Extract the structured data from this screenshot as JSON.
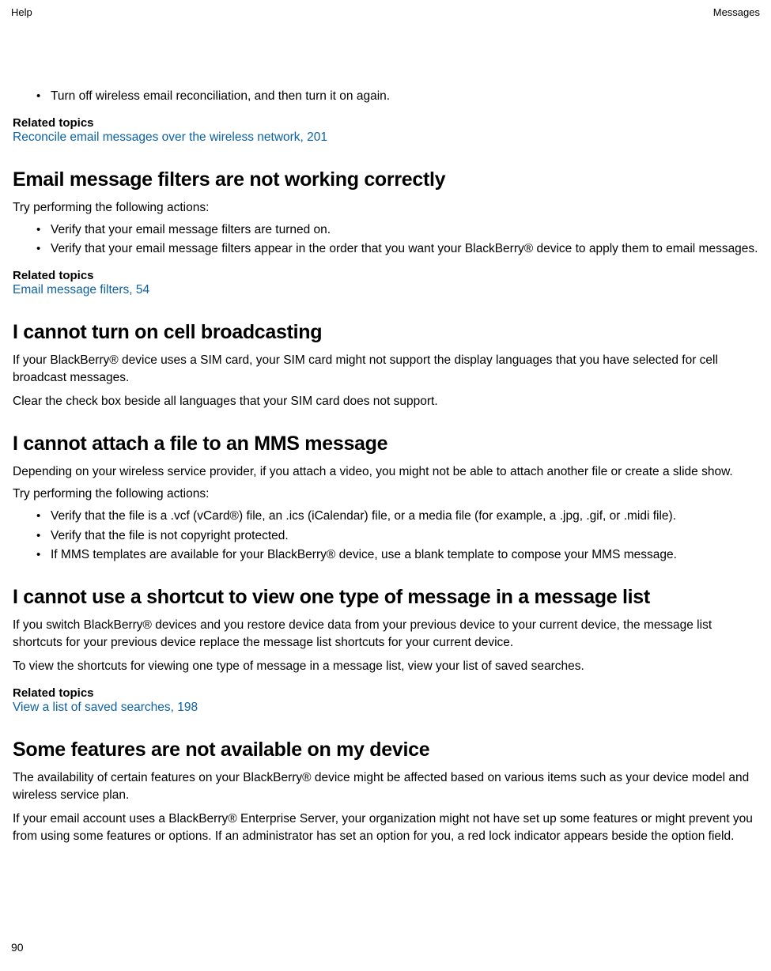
{
  "header": {
    "left": "Help",
    "right": "Messages"
  },
  "intro": {
    "bullet": "Turn off wireless email reconciliation, and then turn it on again."
  },
  "rt1": {
    "label": "Related topics",
    "link": "Reconcile email messages over the wireless network, 201"
  },
  "sec_filters": {
    "heading": "Email message filters are not working correctly",
    "intro": "Try performing the following actions:",
    "b1": "Verify that your email message filters are turned on.",
    "b2": "Verify that your email message filters appear in the order that you want your BlackBerry® device to apply them to email messages."
  },
  "rt2": {
    "label": "Related topics",
    "link": "Email message filters, 54"
  },
  "sec_cell": {
    "heading": "I cannot turn on cell broadcasting",
    "p1": "If your BlackBerry® device uses a SIM card, your SIM card might not support the display languages that you have selected for cell broadcast messages.",
    "p2": "Clear the check box beside all languages that your SIM card does not support."
  },
  "sec_mms": {
    "heading": "I cannot attach a file to an MMS message",
    "p1": "Depending on your wireless service provider, if you attach a video, you might not be able to attach another file or create a slide show.",
    "p2": "Try performing the following actions:",
    "b1": "Verify that the file is a .vcf (vCard®) file, an .ics (iCalendar) file, or a media file (for example, a .jpg, .gif, or .midi file).",
    "b2": "Verify that the file is not copyright protected.",
    "b3": "If MMS templates are available for your BlackBerry® device, use a blank template to compose your MMS message."
  },
  "sec_shortcut": {
    "heading": "I cannot use a shortcut to view one type of message in a message list",
    "p1": "If you switch BlackBerry® devices and you restore device data from your previous device to your current device, the message list shortcuts for your previous device replace the message list shortcuts for your current device.",
    "p2": "To view the shortcuts for viewing one type of message in a message list, view your list of saved searches."
  },
  "rt3": {
    "label": "Related topics",
    "link": "View a list of saved searches, 198"
  },
  "sec_features": {
    "heading": "Some features are not available on my device",
    "p1": "The availability of certain features on your BlackBerry® device might be affected based on various items such as your device model and wireless service plan.",
    "p2": "If your email account uses a BlackBerry® Enterprise Server, your organization might not have set up some features or might prevent you from using some features or options. If an administrator has set an option for you, a red lock indicator appears beside the option field."
  },
  "page_number": "90"
}
